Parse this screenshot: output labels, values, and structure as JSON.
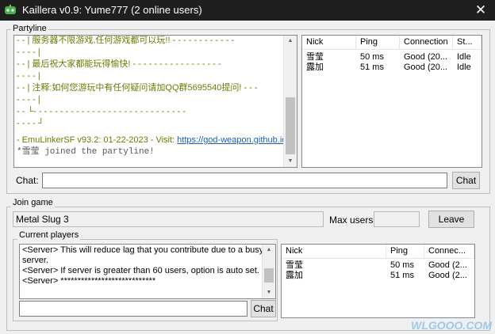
{
  "window": {
    "title": "Kaillera v0.9: Yume777 (2 online users)",
    "close_glyph": "✕"
  },
  "partyline": {
    "label": "Partyline",
    "messages": [
      {
        "text": "- - | 服务器不限游戏,任何游戏都可以玩!! - - - - - - - - - - - -"
      },
      {
        "text": "- - - - |"
      },
      {
        "text": "- - | 最后祝大家都能玩得愉快! - - - - - - - - - - - - - - - - -"
      },
      {
        "text": "- - - - |"
      },
      {
        "text": "- - | 注释:如何您游玩中有任何疑问请加QQ群5695540提问! - - -"
      },
      {
        "text": "- - - - |"
      },
      {
        "text": "- - └- - - - - - - - - - - - - - - - - - - - - - - - - - - - -"
      },
      {
        "text": "- - - - ┘"
      }
    ],
    "emulinker": {
      "text": "- EmuLinkerSF v93.2: 01-22-2023 - Visit: ",
      "link": "https://god-weapon.github.io"
    },
    "join_notice": {
      "prefix": "*",
      "name": "雪莹",
      "text": " joined the partyline!"
    },
    "users_columns": [
      "Nick",
      "Ping",
      "Connection",
      "St..."
    ],
    "users": [
      {
        "nick": "雪莹",
        "ping": "50 ms",
        "connection": "Good (20...",
        "status": "Idle"
      },
      {
        "nick": "露加",
        "ping": "51 ms",
        "connection": "Good (20...",
        "status": "Idle"
      }
    ],
    "chat_label": "Chat:",
    "chat_button": "Chat"
  },
  "join_game": {
    "label": "Join game",
    "game_name": "Metal Slug 3",
    "max_users_label": "Max users:",
    "leave_button": "Leave",
    "current_players_label": "Current players",
    "server_messages": [
      "<Server> This will reduce lag that you contribute due to a busy",
      "server.",
      "<Server> If server is greater than 60 users, option is auto set.",
      "<Server> ****************************"
    ],
    "players_columns": [
      "Nick",
      "Ping",
      "Connec..."
    ],
    "players": [
      {
        "nick": "雪莹",
        "ping": "50 ms",
        "connection": "Good (2..."
      },
      {
        "nick": "露加",
        "ping": "51 ms",
        "connection": "Good (2..."
      }
    ],
    "chat_button": "Chat"
  },
  "watermark": "WLGOOO.COM",
  "colors": {
    "titlebar": "#1f1f1f",
    "olive_text": "#6b7a00",
    "link": "#1a5fb4"
  }
}
